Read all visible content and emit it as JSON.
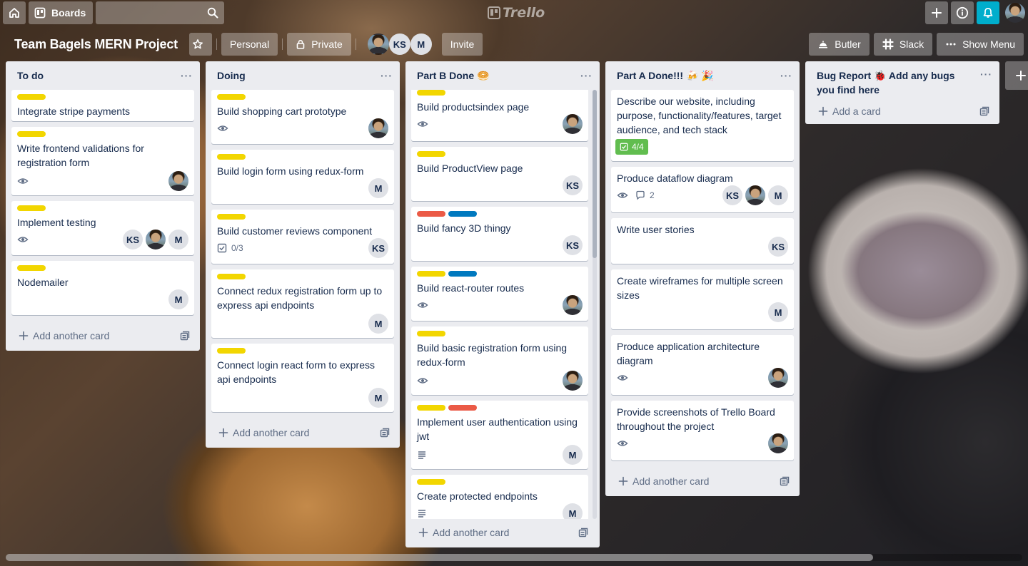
{
  "topnav": {
    "boards_label": "Boards",
    "logo_text": "Trello"
  },
  "board": {
    "title": "Team Bagels MERN Project",
    "visibility_team": "Personal",
    "visibility_privacy": "Private",
    "members": [
      "KS",
      "M"
    ],
    "invite_label": "Invite",
    "butler_label": "Butler",
    "slack_label": "Slack",
    "show_menu_label": "Show Menu"
  },
  "lists": [
    {
      "title": "To do",
      "add_label": "Add another card",
      "cards": [
        {
          "title": "Integrate stripe payments"
        },
        {
          "title": "Write frontend validations for registration form"
        },
        {
          "title": "Implement testing",
          "members": [
            "KS",
            "M"
          ]
        },
        {
          "title": "Nodemailer",
          "members": [
            "M"
          ]
        }
      ]
    },
    {
      "title": "Doing",
      "add_label": "Add another card",
      "cards": [
        {
          "title": "Build shopping cart prototype"
        },
        {
          "title": "Build login form using redux-form",
          "members": [
            "M"
          ]
        },
        {
          "title": "Build customer reviews component",
          "checklist": "0/3",
          "members": [
            "KS"
          ]
        },
        {
          "title": "Connect redux registration form up to express api endpoints",
          "members": [
            "M"
          ]
        },
        {
          "title": "Connect login react form to express api endpoints",
          "members": [
            "M"
          ]
        }
      ]
    },
    {
      "title": "Part B Done 🥯",
      "add_label": "Add another card",
      "cards": [
        {
          "title": "Build productsindex page"
        },
        {
          "title": "Build ProductView page",
          "members": [
            "KS"
          ]
        },
        {
          "title": "Build fancy 3D thingy",
          "members": [
            "KS"
          ]
        },
        {
          "title": "Build react-router routes"
        },
        {
          "title": "Build basic registration form using redux-form"
        },
        {
          "title": "Implement user authentication using jwt",
          "members": [
            "M"
          ]
        },
        {
          "title": "Create protected endpoints",
          "members": [
            "M"
          ]
        }
      ]
    },
    {
      "title": "Part A Done!!! 🍻 🎉",
      "add_label": "Add another card",
      "cards": [
        {
          "title": "Describe our website, including purpose, functionality/features, target audience, and tech stack",
          "checklist": "4/4"
        },
        {
          "title": "Produce dataflow diagram",
          "comments": "2",
          "members": [
            "KS",
            "M"
          ]
        },
        {
          "title": "Write user stories",
          "members": [
            "KS"
          ]
        },
        {
          "title": "Create wireframes for multiple screen sizes",
          "members": [
            "M"
          ]
        },
        {
          "title": "Produce application architecture diagram"
        },
        {
          "title": "Provide screenshots of Trello Board throughout the project"
        }
      ]
    },
    {
      "title": "Bug Report 🐞 Add any bugs you find here",
      "add_label": "Add a card",
      "cards": []
    }
  ],
  "colors": {
    "label_yellow": "#f2d600",
    "label_red": "#eb5a46",
    "label_blue": "#0079bf",
    "notification": "#00aecc",
    "checklist_complete": "#61bd4f"
  }
}
